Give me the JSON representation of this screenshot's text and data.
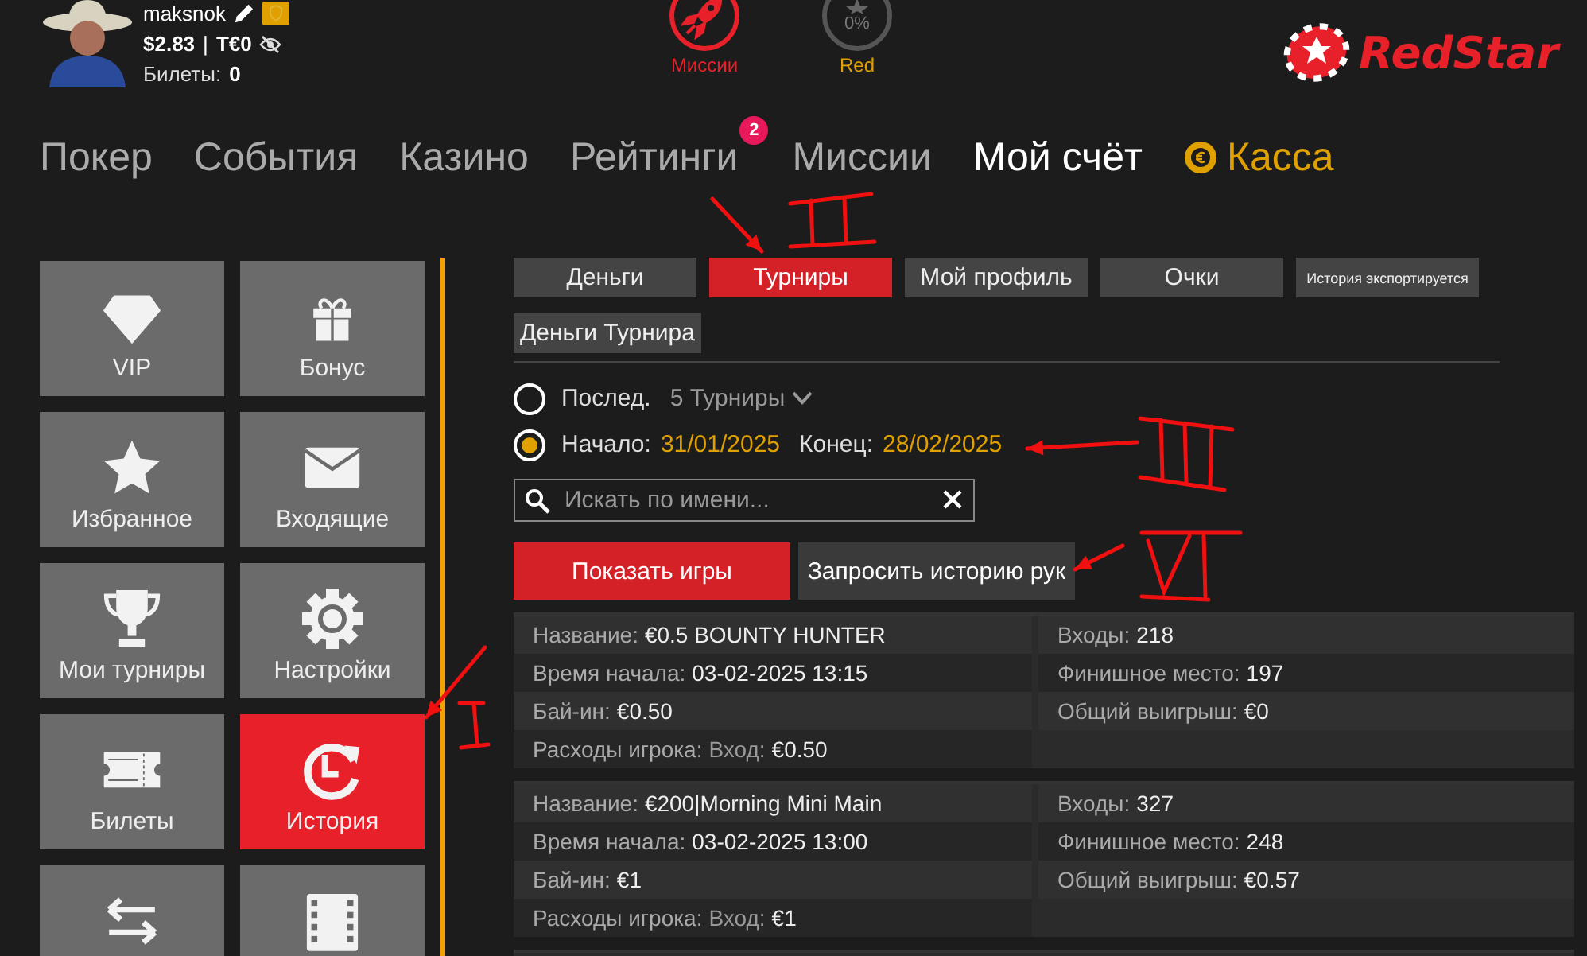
{
  "user": {
    "name": "maksnok",
    "balance": "$2.83",
    "separator": "|",
    "tournament_balance": "T€0",
    "tickets_label": "Билеты:",
    "tickets": "0"
  },
  "header_badges": [
    {
      "kind": "missions",
      "label": "Миссии"
    },
    {
      "kind": "status",
      "label": "Red",
      "reading": "0%"
    }
  ],
  "logo": "RedStar",
  "nav": [
    {
      "label": "Покер",
      "kind": "link",
      "selected": false
    },
    {
      "label": "События",
      "kind": "link",
      "selected": false
    },
    {
      "label": "Казино",
      "kind": "link",
      "selected": false
    },
    {
      "label": "Рейтинги",
      "kind": "link",
      "selected": false,
      "badge": "2"
    },
    {
      "label": "Миссии",
      "kind": "link",
      "selected": false
    },
    {
      "label": "Мой счёт",
      "kind": "link",
      "selected": true
    },
    {
      "label": "Касса",
      "kind": "cashier",
      "selected": false
    }
  ],
  "sidebar": {
    "tiles": [
      {
        "label": "VIP",
        "kind": "diamond",
        "selected": false
      },
      {
        "label": "Бонус",
        "kind": "gift",
        "selected": false
      },
      {
        "label": "Избранное",
        "kind": "star",
        "selected": false
      },
      {
        "label": "Входящие",
        "kind": "envelope",
        "selected": false
      },
      {
        "label": "Мои турниры",
        "kind": "trophy",
        "selected": false
      },
      {
        "label": "Настройки",
        "kind": "gear",
        "selected": false
      },
      {
        "label": "Билеты",
        "kind": "ticket",
        "selected": false
      },
      {
        "label": "История",
        "kind": "history",
        "selected": true
      },
      {
        "kind": "transfer",
        "selected": false
      },
      {
        "kind": "film",
        "selected": false
      }
    ]
  },
  "tabs": [
    {
      "label": "Деньги",
      "kind": "normal",
      "selected": false
    },
    {
      "label": "Турниры",
      "kind": "normal",
      "selected": true
    },
    {
      "label": "Мой профиль",
      "kind": "normal",
      "selected": false
    },
    {
      "label": "Очки",
      "kind": "normal",
      "selected": false
    },
    {
      "label": "История экспортируется",
      "kind": "small",
      "selected": false
    },
    {
      "label": "Деньги Турнира",
      "kind": "normal",
      "selected": false
    }
  ],
  "filter": {
    "options": [
      {
        "kind": "last",
        "label": "Послед.",
        "value": "5 Турниры",
        "selected": false
      },
      {
        "kind": "range",
        "label": "Начало:",
        "value": "31/01/2025",
        "label_2": "Конец:",
        "value_2": "28/02/2025",
        "selected": true
      }
    ],
    "search": {
      "placeholder": "Искать по имени..."
    },
    "buttons": [
      {
        "label": "Показать игры",
        "kind": "primary"
      },
      {
        "label": "Запросить историю рук",
        "kind": "secondary"
      }
    ]
  },
  "results": [
    {
      "rows": [
        {
          "left": {
            "label": "Название:",
            "value": "€0.5 BOUNTY HUNTER"
          },
          "right": {
            "label": "Входы:",
            "value": "218"
          }
        },
        {
          "left": {
            "label": "Время начала:",
            "value": "03-02-2025 13:15"
          },
          "right": {
            "label": "Финишное место:",
            "value": "197"
          }
        },
        {
          "left": {
            "label": "Бай-ин:",
            "value": "€0.50"
          },
          "right": {
            "label": "Общий выигрыш:",
            "value": "€0"
          }
        },
        {
          "left": {
            "label": "Расходы игрока:",
            "sublabel": "Вход:",
            "value": "€0.50"
          }
        }
      ]
    },
    {
      "rows": [
        {
          "left": {
            "label": "Название:",
            "value": "€200|Morning Mini Main"
          },
          "right": {
            "label": "Входы:",
            "value": "327"
          }
        },
        {
          "left": {
            "label": "Время начала:",
            "value": "03-02-2025 13:00"
          },
          "right": {
            "label": "Финишное место:",
            "value": "248"
          }
        },
        {
          "left": {
            "label": "Бай-ин:",
            "value": "€1"
          },
          "right": {
            "label": "Общий выигрыш:",
            "value": "€0.57"
          }
        },
        {
          "left": {
            "label": "Расходы игрока:",
            "sublabel": "Вход:",
            "value": "€1"
          }
        }
      ]
    }
  ]
}
